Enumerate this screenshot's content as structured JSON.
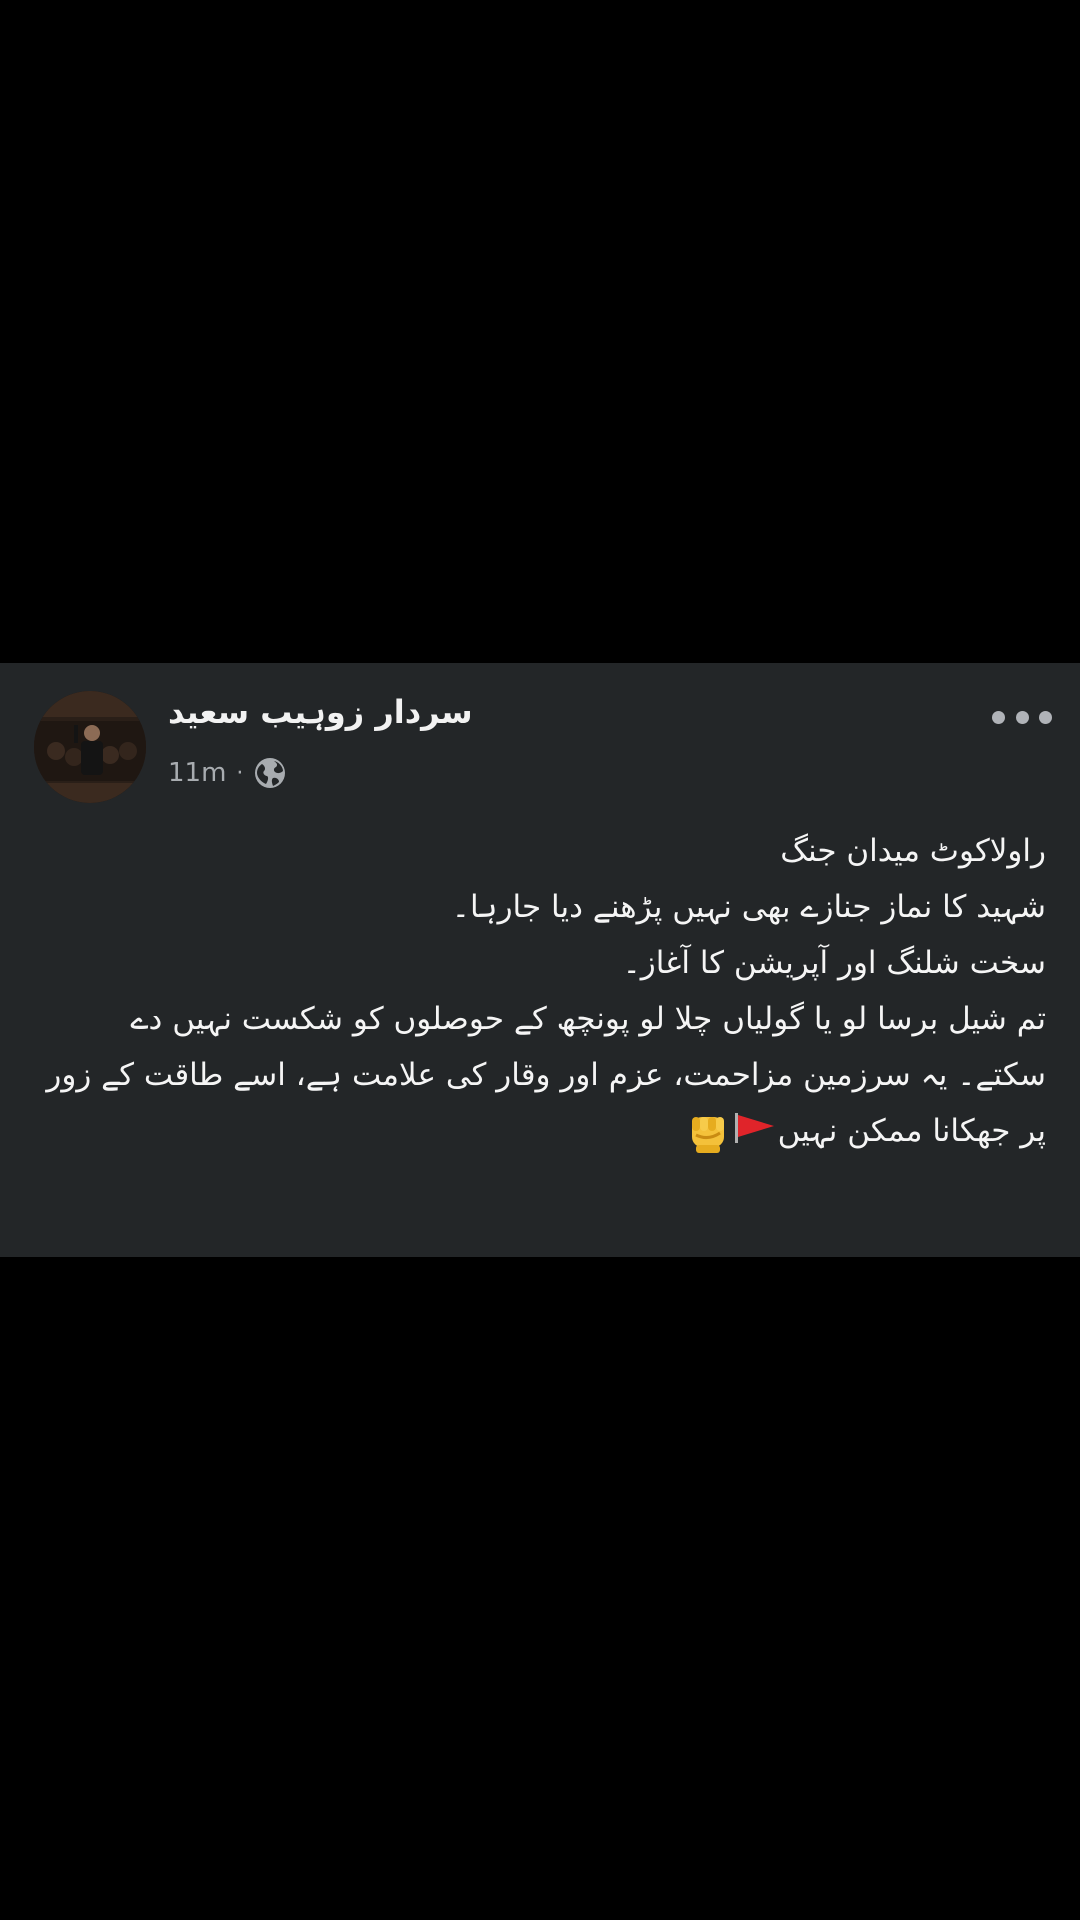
{
  "post": {
    "author_name": "سردار زوہیب سعید",
    "timestamp": "11m",
    "separator": "·",
    "privacy_icon": "globe-icon",
    "more_icon": "more-horizontal-icon",
    "text_lines": [
      "راولاکوٹ میدان جنگ",
      "شہید کا نماز جنازے بھی نہیں پڑھنے دیا جارہا۔",
      "سخت شلنگ اور آپریشن کا آغاز۔",
      "تم شیل برسا لو یا گولیاں چلا لو پونچھ کے حوصلوں کو شکست نہیں دے سکتے۔ یہ سرزمین مزاحمت، عزم اور وقار کی علامت ہے، اسے طاقت کے زور پر جھکانا ممکن نہیں"
    ],
    "emojis": [
      "red-flag-icon",
      "raised-fist-icon"
    ]
  },
  "colors": {
    "page_background": "#000000",
    "card_background": "#232628",
    "text_primary": "#f5f5f5",
    "text_secondary": "#a8acb0"
  }
}
